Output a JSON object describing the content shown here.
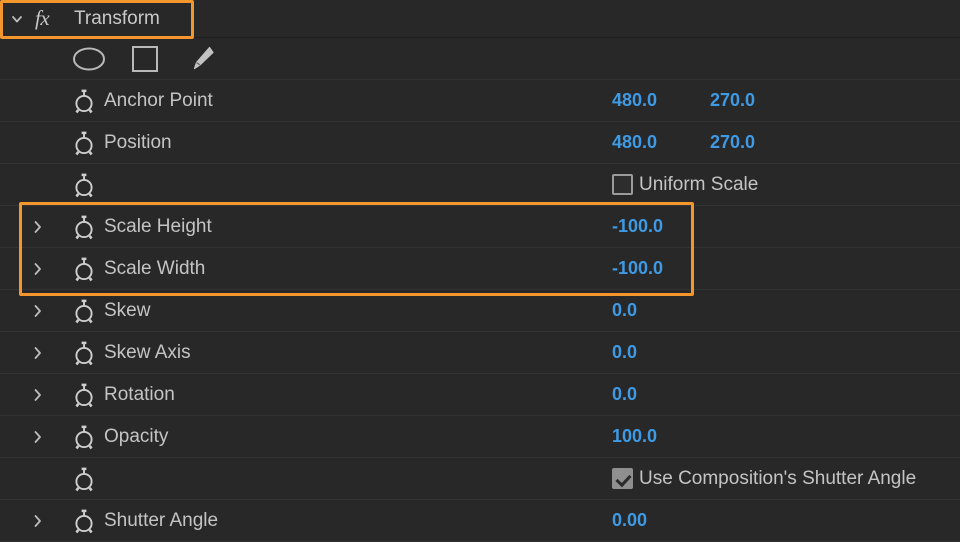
{
  "effect": {
    "name": "Transform",
    "fx_label": "fx",
    "expanded": true
  },
  "shape_tools": [
    {
      "name": "ellipse-tool",
      "glyph": "ellipse"
    },
    {
      "name": "rectangle-tool",
      "glyph": "rectangle"
    },
    {
      "name": "pen-tool",
      "glyph": "pen"
    }
  ],
  "properties": [
    {
      "label": "Anchor Point",
      "type": "pair",
      "value_x": "480.0",
      "value_y": "270.0",
      "has_chevron": false,
      "has_stopwatch": true,
      "highlighted": false
    },
    {
      "label": "Position",
      "type": "pair",
      "value_x": "480.0",
      "value_y": "270.0",
      "has_chevron": false,
      "has_stopwatch": true,
      "highlighted": false
    },
    {
      "label": "",
      "type": "checkbox",
      "checkbox_label": "Uniform Scale",
      "checked": false,
      "has_chevron": false,
      "has_stopwatch": true,
      "highlighted": false
    },
    {
      "label": "Scale Height",
      "type": "single",
      "value_x": "-100.0",
      "has_chevron": true,
      "has_stopwatch": true,
      "highlighted": true
    },
    {
      "label": "Scale Width",
      "type": "single",
      "value_x": "-100.0",
      "has_chevron": true,
      "has_stopwatch": true,
      "highlighted": true
    },
    {
      "label": "Skew",
      "type": "single",
      "value_x": "0.0",
      "has_chevron": true,
      "has_stopwatch": true,
      "highlighted": false
    },
    {
      "label": "Skew Axis",
      "type": "single",
      "value_x": "0.0",
      "has_chevron": true,
      "has_stopwatch": true,
      "highlighted": false
    },
    {
      "label": "Rotation",
      "type": "single",
      "value_x": "0.0",
      "has_chevron": true,
      "has_stopwatch": true,
      "highlighted": false
    },
    {
      "label": "Opacity",
      "type": "single",
      "value_x": "100.0",
      "has_chevron": true,
      "has_stopwatch": true,
      "highlighted": false
    },
    {
      "label": "",
      "type": "checkbox",
      "checkbox_label": "Use Composition's Shutter Angle",
      "checked": true,
      "has_chevron": false,
      "has_stopwatch": true,
      "highlighted": false
    },
    {
      "label": "Shutter Angle",
      "type": "single",
      "value_x": "0.00",
      "has_chevron": true,
      "has_stopwatch": true,
      "highlighted": false
    }
  ],
  "colors": {
    "background": "#282828",
    "value_blue": "#3f9ae6",
    "label_gray": "#c4c4c4",
    "highlight_orange": "#f2962d",
    "row_divider": "#333333"
  }
}
